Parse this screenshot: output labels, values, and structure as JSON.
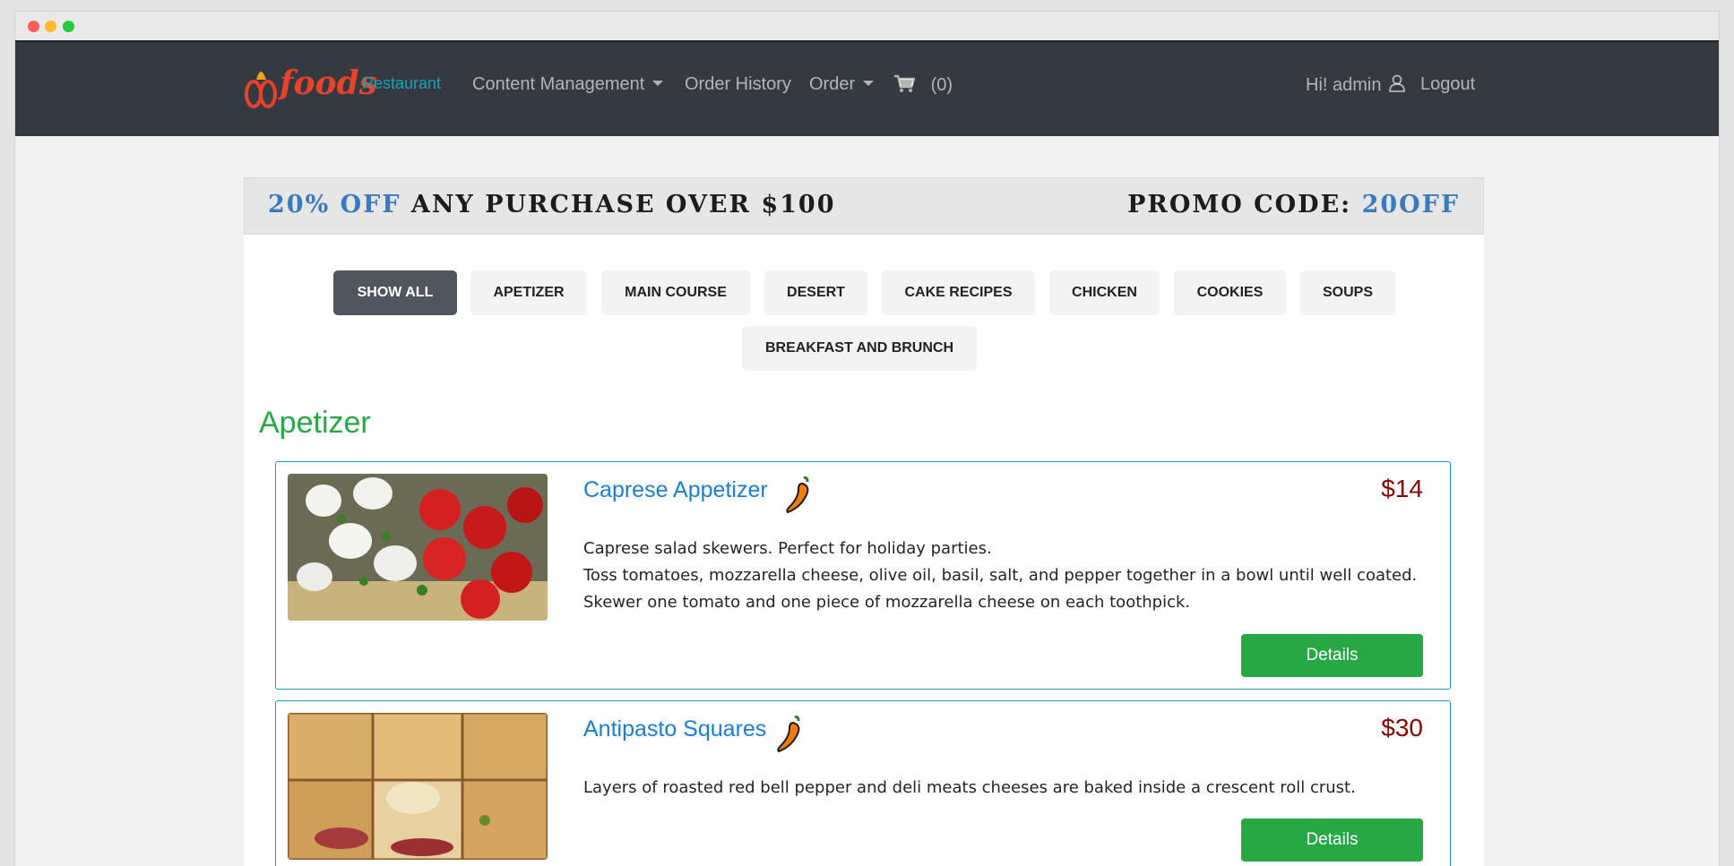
{
  "nav": {
    "logo_text": "foods",
    "brand": "Restaurant",
    "content_management": "Content Management",
    "order_history": "Order History",
    "order": "Order",
    "cart_count": "(0)",
    "greeting": "Hi! admin",
    "logout": "Logout"
  },
  "promo": {
    "left_highlight": "20% OFF",
    "left_text": "ANY PURCHASE OVER $100",
    "right_text": "PROMO CODE:",
    "right_highlight": "20OFF"
  },
  "filters": [
    {
      "label": "SHOW ALL",
      "active": true
    },
    {
      "label": "APETIZER",
      "active": false
    },
    {
      "label": "MAIN COURSE",
      "active": false
    },
    {
      "label": "DESERT",
      "active": false
    },
    {
      "label": "CAKE RECIPES",
      "active": false
    },
    {
      "label": "CHICKEN",
      "active": false
    },
    {
      "label": "COOKIES",
      "active": false
    },
    {
      "label": "SOUPS",
      "active": false
    },
    {
      "label": "BREAKFAST AND BRUNCH",
      "active": false
    }
  ],
  "section": {
    "title": "Apetizer"
  },
  "items": [
    {
      "name": "Caprese Appetizer",
      "price": "$14",
      "description": [
        "Caprese salad skewers. Perfect for holiday parties.",
        "Toss tomatoes, mozzarella cheese, olive oil, basil, salt, and pepper together in a bowl until well coated.",
        "Skewer one tomato and one piece of mozzarella cheese on each toothpick."
      ],
      "button": "Details"
    },
    {
      "name": "Antipasto Squares",
      "price": "$30",
      "description": [
        "Layers of roasted red bell pepper and deli meats cheeses are baked inside a crescent roll crust."
      ],
      "button": "Details"
    }
  ],
  "colors": {
    "navbar": "#343a40",
    "accent_green": "#28a745",
    "price_red": "#8b0000",
    "link_blue": "#1b7ed6",
    "card_border": "#17a2b8"
  }
}
